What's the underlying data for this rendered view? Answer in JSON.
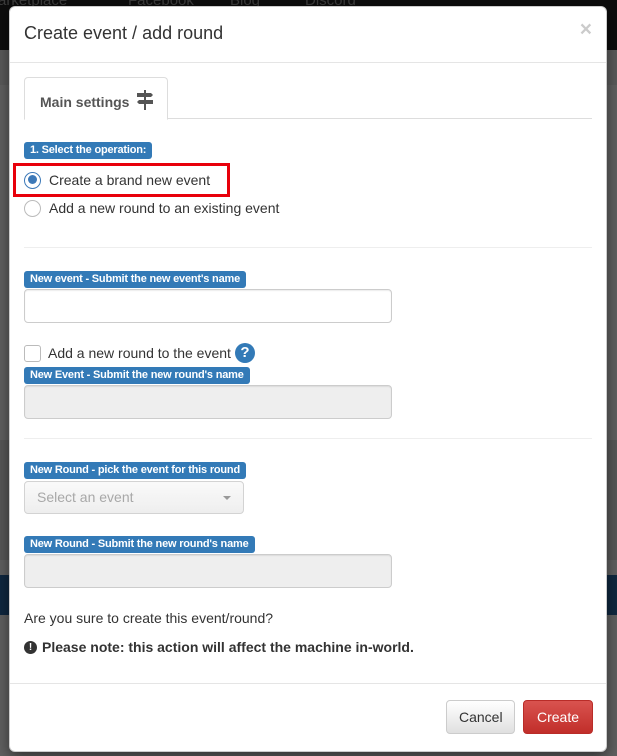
{
  "background": {
    "nav_items": [
      "arketplace",
      "Facebook",
      "Blog",
      "Discord"
    ]
  },
  "modal": {
    "title": "Create event / add round",
    "close_symbol": "×",
    "tabs": [
      {
        "label": "Main settings",
        "icon": "signpost-icon",
        "active": true
      }
    ],
    "operation": {
      "label": "1. Select the operation:",
      "options": [
        {
          "label": "Create a brand new event",
          "checked": true
        },
        {
          "label": "Add a new round to an existing event",
          "checked": false
        }
      ]
    },
    "new_event_name": {
      "label": "New event - Submit the new event's name",
      "value": "",
      "placeholder": ""
    },
    "add_round_checkbox": {
      "label": "Add a new round to the event",
      "checked": false,
      "help_symbol": "?"
    },
    "new_event_round_name": {
      "label": "New Event - Submit the new round's name",
      "value": "",
      "disabled": true
    },
    "new_round_event_select": {
      "label": "New Round - pick the event for this round",
      "placeholder": "Select an event",
      "disabled": true
    },
    "new_round_name": {
      "label": "New Round - Submit the new round's name",
      "value": "",
      "disabled": true
    },
    "confirm_text": "Are you sure to create this event/round?",
    "note_symbol": "!",
    "note_text": "Please note: this action will affect the machine in-world.",
    "buttons": {
      "cancel": "Cancel",
      "create": "Create"
    }
  },
  "colors": {
    "primary": "#337ab7",
    "danger": "#d9534f",
    "highlight": "#e8000b"
  }
}
